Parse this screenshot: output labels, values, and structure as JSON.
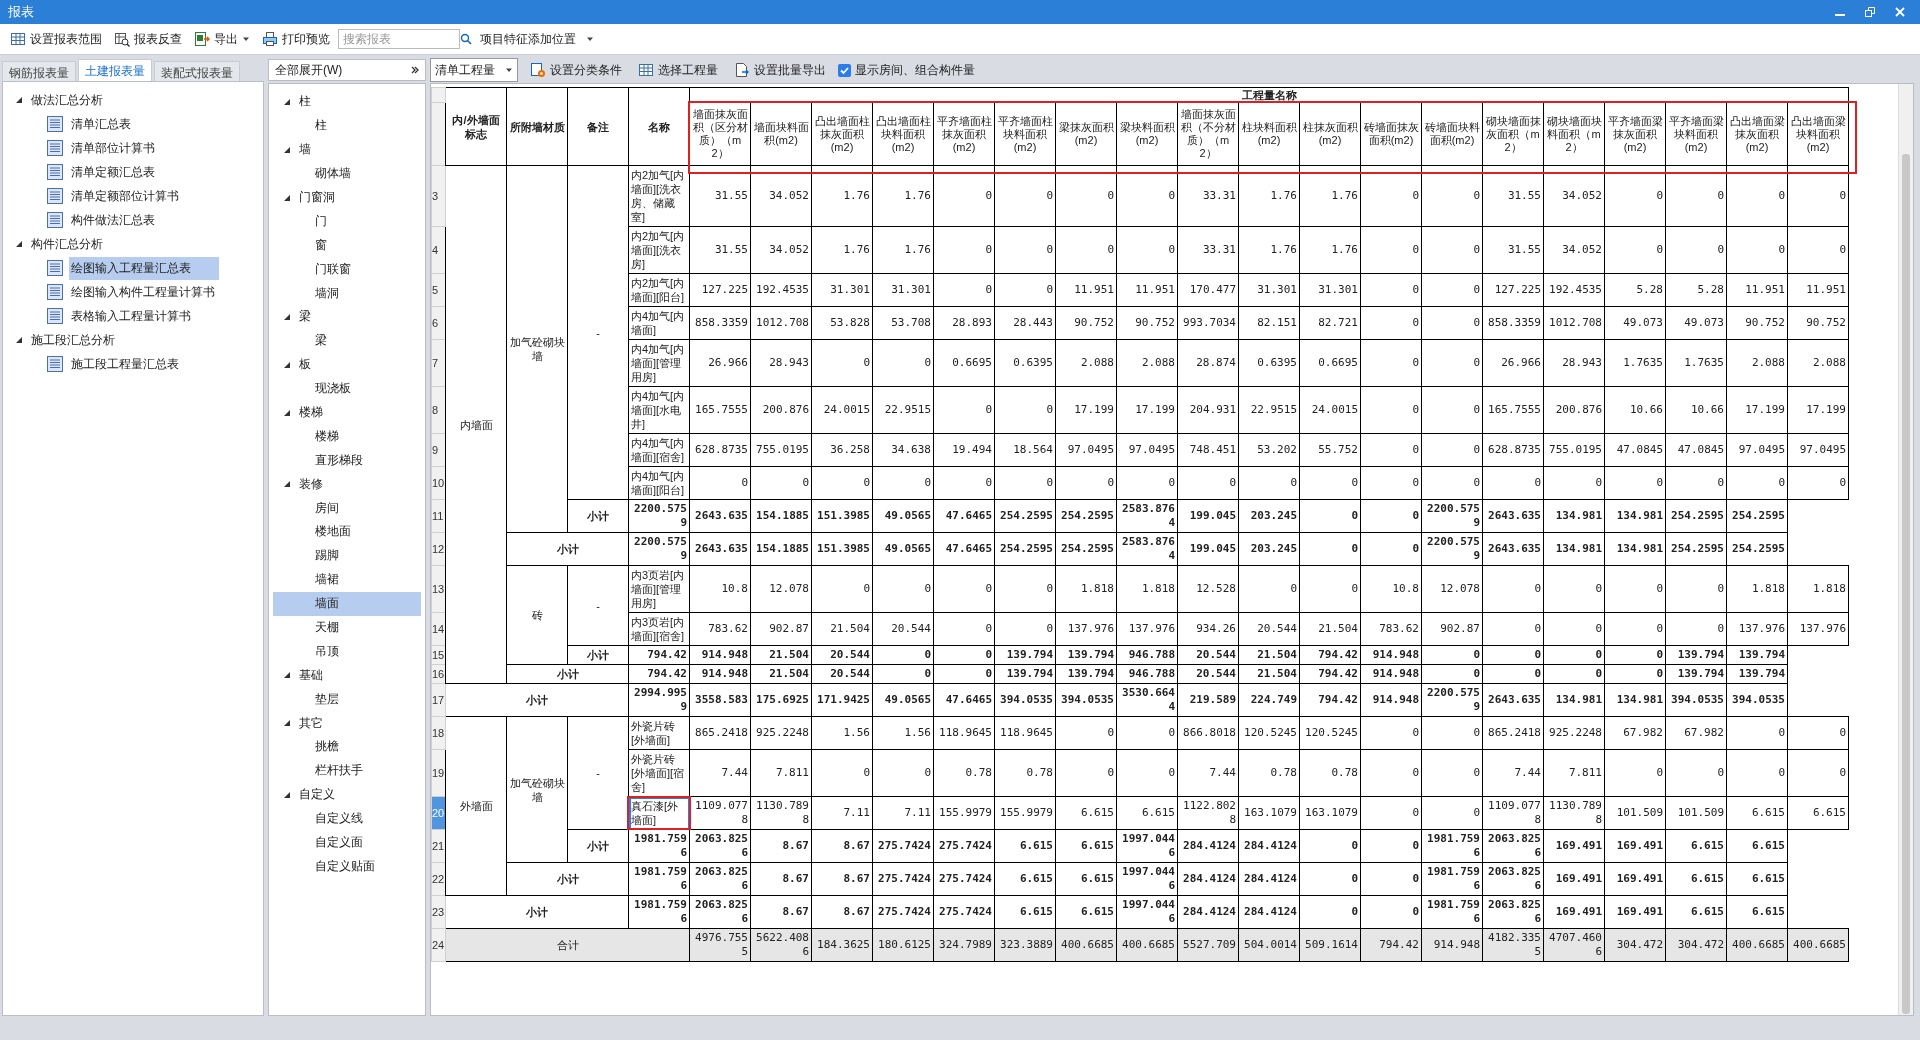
{
  "window": {
    "title": "报表"
  },
  "toolbar": [
    {
      "kind": "button",
      "label": "设置报表范围"
    },
    {
      "kind": "button",
      "label": "报表反查"
    },
    {
      "kind": "menu-button",
      "label": "导出"
    },
    {
      "kind": "button",
      "label": "打印预览"
    },
    {
      "kind": "search",
      "placeholder": "搜索报表"
    },
    {
      "kind": "dropdown",
      "value": "项目特征添加位置"
    }
  ],
  "tabs": [
    {
      "label": "钢筋报表量",
      "selected": false
    },
    {
      "label": "土建报表量",
      "selected": true
    },
    {
      "label": "装配式报表量",
      "selected": false
    }
  ],
  "report_tree": [
    {
      "label": "做法汇总分析",
      "expanded": true,
      "children": [
        {
          "label": "清单汇总表",
          "selected": false
        },
        {
          "label": "清单部位计算书",
          "selected": false
        },
        {
          "label": "清单定额汇总表",
          "selected": false
        },
        {
          "label": "清单定额部位计算书",
          "selected": false
        },
        {
          "label": "构件做法汇总表",
          "selected": false
        }
      ]
    },
    {
      "label": "构件汇总分析",
      "expanded": true,
      "children": [
        {
          "label": "绘图输入工程量汇总表",
          "selected": true
        },
        {
          "label": "绘图输入构件工程量计算书",
          "selected": false
        },
        {
          "label": "表格输入工程量计算书",
          "selected": false
        }
      ]
    },
    {
      "label": "施工段汇总分析",
      "expanded": true,
      "children": [
        {
          "label": "施工段工程量汇总表",
          "selected": false
        }
      ]
    }
  ],
  "category_tree": {
    "dropdown": "全部展开(W)",
    "items": [
      {
        "label": "柱",
        "expanded": true,
        "children": [
          {
            "label": "柱",
            "selected": false
          }
        ]
      },
      {
        "label": "墙",
        "expanded": true,
        "children": [
          {
            "label": "砌体墙",
            "selected": false
          }
        ]
      },
      {
        "label": "门窗洞",
        "expanded": true,
        "children": [
          {
            "label": "门",
            "selected": false
          },
          {
            "label": "窗",
            "selected": false
          },
          {
            "label": "门联窗",
            "selected": false
          },
          {
            "label": "墙洞",
            "selected": false
          }
        ]
      },
      {
        "label": "梁",
        "expanded": true,
        "children": [
          {
            "label": "梁",
            "selected": false
          }
        ]
      },
      {
        "label": "板",
        "expanded": true,
        "children": [
          {
            "label": "现浇板",
            "selected": false
          }
        ]
      },
      {
        "label": "楼梯",
        "expanded": true,
        "children": [
          {
            "label": "楼梯",
            "selected": false
          },
          {
            "label": "直形梯段",
            "selected": false
          }
        ]
      },
      {
        "label": "装修",
        "expanded": true,
        "children": [
          {
            "label": "房间",
            "selected": false
          },
          {
            "label": "楼地面",
            "selected": false
          },
          {
            "label": "踢脚",
            "selected": false
          },
          {
            "label": "墙裙",
            "selected": false
          },
          {
            "label": "墙面",
            "selected": true
          },
          {
            "label": "天棚",
            "selected": false
          },
          {
            "label": "吊顶",
            "selected": false
          }
        ]
      },
      {
        "label": "基础",
        "expanded": true,
        "children": [
          {
            "label": "垫层",
            "selected": false
          }
        ]
      },
      {
        "label": "其它",
        "expanded": true,
        "children": [
          {
            "label": "挑檐",
            "selected": false
          },
          {
            "label": "栏杆扶手",
            "selected": false
          }
        ]
      },
      {
        "label": "自定义",
        "expanded": true,
        "children": [
          {
            "label": "自定义线",
            "selected": false
          },
          {
            "label": "自定义面",
            "selected": false
          },
          {
            "label": "自定义贴面",
            "selected": false
          }
        ]
      }
    ]
  },
  "table_toolbar": [
    {
      "kind": "dropdown",
      "value": "清单工程量"
    },
    {
      "kind": "button",
      "label": "设置分类条件"
    },
    {
      "kind": "button",
      "label": "选择工程量"
    },
    {
      "kind": "button",
      "label": "设置批量导出"
    },
    {
      "kind": "checkbox",
      "label": "显示房间、组合构件量",
      "checked": true
    }
  ],
  "table": {
    "header": {
      "wall_side": "内/外墙面标志",
      "material": "所附墙材质",
      "remark": "备注",
      "name": "名称",
      "quantity_group": "工程量名称",
      "highlighted": true
    },
    "columns": [
      "墙面抹灰面积（区分材质）（m2）",
      "墙面块料面积(m2)",
      "凸出墙面柱抹灰面积(m2)",
      "凸出墙面柱块料面积(m2)",
      "平齐墙面柱抹灰面积(m2)",
      "平齐墙面柱块料面积(m2)",
      "梁抹灰面积(m2)",
      "梁块料面积(m2)",
      "墙面抹灰面积（不分材质）（m2）",
      "柱块料面积(m2)",
      "柱抹灰面积(m2)",
      "砖墙面抹灰面积(m2)",
      "砖墙面块料面积(m2)",
      "砌块墙面抹灰面积（m2）",
      "砌块墙面块料面积（m2）",
      "平齐墙面梁抹灰面积(m2)",
      "平齐墙面梁块料面积(m2)",
      "凸出墙面梁抹灰面积(m2)",
      "凸出墙面梁块料面积(m2)"
    ],
    "groups": [
      {
        "wall_side": "内墙面",
        "materials": [
          {
            "material": "加气砼砌块墙",
            "remarks": [
              {
                "remark": "-",
                "items": [
                  {
                    "row": "3",
                    "name": "内2加气[内墙面][洗衣房、储藏室]",
                    "selected": false,
                    "highlighted": false,
                    "values": [
                      "31.55",
                      "34.052",
                      "1.76",
                      "1.76",
                      "0",
                      "0",
                      "0",
                      "0",
                      "33.31",
                      "1.76",
                      "1.76",
                      "0",
                      "0",
                      "31.55",
                      "34.052",
                      "0",
                      "0",
                      "0",
                      "0"
                    ]
                  },
                  {
                    "row": "4",
                    "name": "内2加气[内墙面][洗衣房]",
                    "selected": false,
                    "highlighted": false,
                    "values": [
                      "31.55",
                      "34.052",
                      "1.76",
                      "1.76",
                      "0",
                      "0",
                      "0",
                      "0",
                      "33.31",
                      "1.76",
                      "1.76",
                      "0",
                      "0",
                      "31.55",
                      "34.052",
                      "0",
                      "0",
                      "0",
                      "0"
                    ]
                  },
                  {
                    "row": "5",
                    "name": "内2加气[内墙面][阳台]",
                    "selected": false,
                    "highlighted": false,
                    "values": [
                      "127.225",
                      "192.4535",
                      "31.301",
                      "31.301",
                      "0",
                      "0",
                      "11.951",
                      "11.951",
                      "170.477",
                      "31.301",
                      "31.301",
                      "0",
                      "0",
                      "127.225",
                      "192.4535",
                      "5.28",
                      "5.28",
                      "11.951",
                      "11.951"
                    ]
                  },
                  {
                    "row": "6",
                    "name": "内4加气[内墙面]",
                    "selected": false,
                    "highlighted": false,
                    "values": [
                      "858.3359",
                      "1012.708",
                      "53.828",
                      "53.708",
                      "28.893",
                      "28.443",
                      "90.752",
                      "90.752",
                      "993.7034",
                      "82.151",
                      "82.721",
                      "0",
                      "0",
                      "858.3359",
                      "1012.708",
                      "49.073",
                      "49.073",
                      "90.752",
                      "90.752"
                    ]
                  },
                  {
                    "row": "7",
                    "name": "内4加气[内墙面][管理用房]",
                    "selected": false,
                    "highlighted": false,
                    "values": [
                      "26.966",
                      "28.943",
                      "0",
                      "0",
                      "0.6695",
                      "0.6395",
                      "2.088",
                      "2.088",
                      "28.874",
                      "0.6395",
                      "0.6695",
                      "0",
                      "0",
                      "26.966",
                      "28.943",
                      "1.7635",
                      "1.7635",
                      "2.088",
                      "2.088"
                    ]
                  },
                  {
                    "row": "8",
                    "name": "内4加气[内墙面][水电井]",
                    "selected": false,
                    "highlighted": false,
                    "values": [
                      "165.7555",
                      "200.876",
                      "24.0015",
                      "22.9515",
                      "0",
                      "0",
                      "17.199",
                      "17.199",
                      "204.931",
                      "22.9515",
                      "24.0015",
                      "0",
                      "0",
                      "165.7555",
                      "200.876",
                      "10.66",
                      "10.66",
                      "17.199",
                      "17.199"
                    ]
                  },
                  {
                    "row": "9",
                    "name": "内4加气[内墙面][宿舍]",
                    "selected": false,
                    "highlighted": false,
                    "values": [
                      "628.8735",
                      "755.0195",
                      "36.258",
                      "34.638",
                      "19.494",
                      "18.564",
                      "97.0495",
                      "97.0495",
                      "748.451",
                      "53.202",
                      "55.752",
                      "0",
                      "0",
                      "628.8735",
                      "755.0195",
                      "47.0845",
                      "47.0845",
                      "97.0495",
                      "97.0495"
                    ]
                  },
                  {
                    "row": "10",
                    "name": "内4加气[内墙面][阳台]",
                    "selected": false,
                    "highlighted": false,
                    "values": [
                      "0",
                      "0",
                      "0",
                      "0",
                      "0",
                      "0",
                      "0",
                      "0",
                      "0",
                      "0",
                      "0",
                      "0",
                      "0",
                      "0",
                      "0",
                      "0",
                      "0",
                      "0",
                      "0"
                    ]
                  }
                ],
                "subtotal": {
                  "row": "11",
                  "label": "小计",
                  "values": [
                    "2200.5759",
                    "2643.635",
                    "154.1885",
                    "151.3985",
                    "49.0565",
                    "47.6465",
                    "254.2595",
                    "254.2595",
                    "2583.8764",
                    "199.045",
                    "203.245",
                    "0",
                    "0",
                    "2200.5759",
                    "2643.635",
                    "134.981",
                    "134.981",
                    "254.2595",
                    "254.2595"
                  ]
                }
              }
            ],
            "subtotal": {
              "row": "12",
              "label": "小计",
              "values": [
                "2200.5759",
                "2643.635",
                "154.1885",
                "151.3985",
                "49.0565",
                "47.6465",
                "254.2595",
                "254.2595",
                "2583.8764",
                "199.045",
                "203.245",
                "0",
                "0",
                "2200.5759",
                "2643.635",
                "134.981",
                "134.981",
                "254.2595",
                "254.2595"
              ]
            }
          },
          {
            "material": "砖",
            "remarks": [
              {
                "remark": "-",
                "items": [
                  {
                    "row": "13",
                    "name": "内3页岩[内墙面][管理用房]",
                    "selected": false,
                    "highlighted": false,
                    "values": [
                      "10.8",
                      "12.078",
                      "0",
                      "0",
                      "0",
                      "0",
                      "1.818",
                      "1.818",
                      "12.528",
                      "0",
                      "0",
                      "10.8",
                      "12.078",
                      "0",
                      "0",
                      "0",
                      "0",
                      "1.818",
                      "1.818"
                    ]
                  },
                  {
                    "row": "14",
                    "name": "内3页岩[内墙面][宿舍]",
                    "selected": false,
                    "highlighted": false,
                    "values": [
                      "783.62",
                      "902.87",
                      "21.504",
                      "20.544",
                      "0",
                      "0",
                      "137.976",
                      "137.976",
                      "934.26",
                      "20.544",
                      "21.504",
                      "783.62",
                      "902.87",
                      "0",
                      "0",
                      "0",
                      "0",
                      "137.976",
                      "137.976"
                    ]
                  }
                ],
                "subtotal": {
                  "row": "15",
                  "label": "小计",
                  "values": [
                    "794.42",
                    "914.948",
                    "21.504",
                    "20.544",
                    "0",
                    "0",
                    "139.794",
                    "139.794",
                    "946.788",
                    "20.544",
                    "21.504",
                    "794.42",
                    "914.948",
                    "0",
                    "0",
                    "0",
                    "0",
                    "139.794",
                    "139.794"
                  ]
                }
              }
            ],
            "subtotal": {
              "row": "16",
              "label": "小计",
              "values": [
                "794.42",
                "914.948",
                "21.504",
                "20.544",
                "0",
                "0",
                "139.794",
                "139.794",
                "946.788",
                "20.544",
                "21.504",
                "794.42",
                "914.948",
                "0",
                "0",
                "0",
                "0",
                "139.794",
                "139.794"
              ]
            }
          }
        ],
        "subtotal": {
          "row": "17",
          "label": "小计",
          "values": [
            "2994.9959",
            "3558.583",
            "175.6925",
            "171.9425",
            "49.0565",
            "47.6465",
            "394.0535",
            "394.0535",
            "3530.6644",
            "219.589",
            "224.749",
            "794.42",
            "914.948",
            "2200.5759",
            "2643.635",
            "134.981",
            "134.981",
            "394.0535",
            "394.0535"
          ]
        }
      },
      {
        "wall_side": "外墙面",
        "materials": [
          {
            "material": "加气砼砌块墙",
            "remarks": [
              {
                "remark": "-",
                "items": [
                  {
                    "row": "18",
                    "name": "外瓷片砖[外墙面]",
                    "selected": false,
                    "highlighted": false,
                    "values": [
                      "865.2418",
                      "925.2248",
                      "1.56",
                      "1.56",
                      "118.9645",
                      "118.9645",
                      "0",
                      "0",
                      "866.8018",
                      "120.5245",
                      "120.5245",
                      "0",
                      "0",
                      "865.2418",
                      "925.2248",
                      "67.982",
                      "67.982",
                      "0",
                      "0"
                    ]
                  },
                  {
                    "row": "19",
                    "name": "外瓷片砖[外墙面][宿舍]",
                    "selected": false,
                    "highlighted": false,
                    "values": [
                      "7.44",
                      "7.811",
                      "0",
                      "0",
                      "0.78",
                      "0.78",
                      "0",
                      "0",
                      "7.44",
                      "0.78",
                      "0.78",
                      "0",
                      "0",
                      "7.44",
                      "7.811",
                      "0",
                      "0",
                      "0",
                      "0"
                    ]
                  },
                  {
                    "row": "20",
                    "name": "真石漆[外墙面]",
                    "selected": true,
                    "highlighted": true,
                    "values": [
                      "1109.0778",
                      "1130.7898",
                      "7.11",
                      "7.11",
                      "155.9979",
                      "155.9979",
                      "6.615",
                      "6.615",
                      "1122.8028",
                      "163.1079",
                      "163.1079",
                      "0",
                      "0",
                      "1109.0778",
                      "1130.7898",
                      "101.509",
                      "101.509",
                      "6.615",
                      "6.615"
                    ]
                  }
                ],
                "subtotal": {
                  "row": "21",
                  "label": "小计",
                  "values": [
                    "1981.7596",
                    "2063.8256",
                    "8.67",
                    "8.67",
                    "275.7424",
                    "275.7424",
                    "6.615",
                    "6.615",
                    "1997.0446",
                    "284.4124",
                    "284.4124",
                    "0",
                    "0",
                    "1981.7596",
                    "2063.8256",
                    "169.491",
                    "169.491",
                    "6.615",
                    "6.615"
                  ]
                }
              }
            ],
            "subtotal": {
              "row": "22",
              "label": "小计",
              "values": [
                "1981.7596",
                "2063.8256",
                "8.67",
                "8.67",
                "275.7424",
                "275.7424",
                "6.615",
                "6.615",
                "1997.0446",
                "284.4124",
                "284.4124",
                "0",
                "0",
                "1981.7596",
                "2063.8256",
                "169.491",
                "169.491",
                "6.615",
                "6.615"
              ]
            }
          }
        ],
        "subtotal": {
          "row": "23",
          "label": "小计",
          "values": [
            "1981.7596",
            "2063.8256",
            "8.67",
            "8.67",
            "275.7424",
            "275.7424",
            "6.615",
            "6.615",
            "1997.0446",
            "284.4124",
            "284.4124",
            "0",
            "0",
            "1981.7596",
            "2063.8256",
            "169.491",
            "169.491",
            "6.615",
            "6.615"
          ]
        }
      }
    ],
    "total": {
      "row": "24",
      "label": "合计",
      "values": [
        "4976.7555",
        "5622.4086",
        "184.3625",
        "180.6125",
        "324.7989",
        "323.3889",
        "400.6685",
        "400.6685",
        "5527.709",
        "504.0014",
        "509.1614",
        "794.42",
        "914.948",
        "4182.3355",
        "4707.4606",
        "304.472",
        "304.472",
        "400.6685",
        "400.6685"
      ]
    }
  }
}
